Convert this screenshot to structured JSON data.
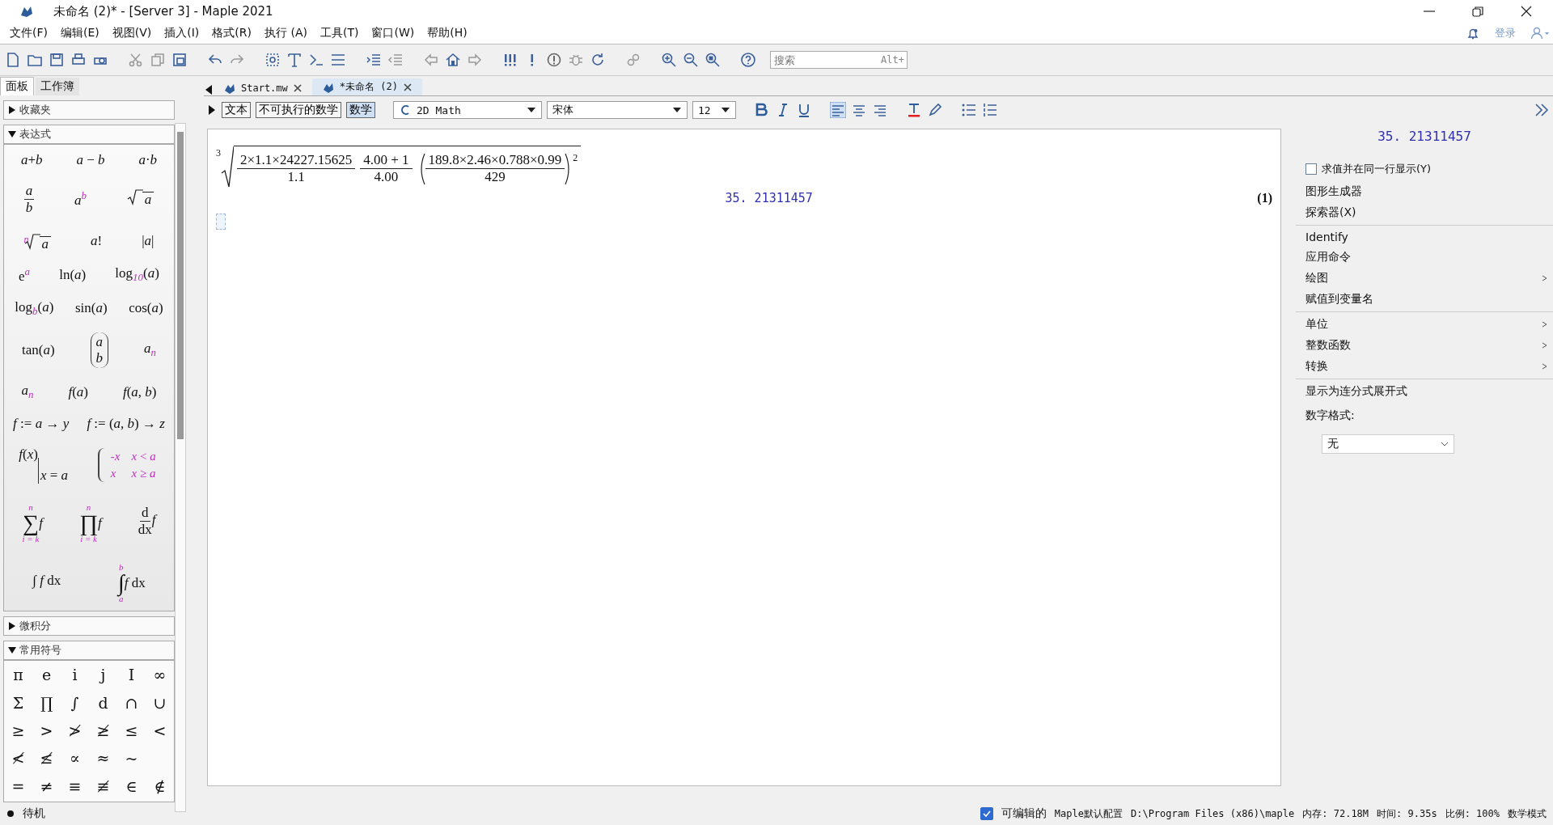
{
  "window": {
    "title": "未命名 (2)* - [Server 3] - Maple 2021",
    "login": "登录"
  },
  "menu": [
    "文件(F)",
    "编辑(E)",
    "视图(V)",
    "插入(I)",
    "格式(R)",
    "执行 (A)",
    "工具(T)",
    "窗口(W)",
    "帮助(H)"
  ],
  "search": {
    "placeholder": "搜索",
    "hint": "Alt+"
  },
  "panel_tabs": [
    {
      "label": "面板",
      "selected": true
    },
    {
      "label": "工作簿",
      "selected": false
    }
  ],
  "doc_tabs": [
    {
      "label": "Start.mw",
      "selected": false
    },
    {
      "label": "*未命名 (2)",
      "selected": true
    }
  ],
  "palettes": [
    {
      "title": "收藏夹",
      "expanded": false
    },
    {
      "title": "表达式",
      "expanded": true,
      "kind": "expressions",
      "rows": [
        [
          {
            "kind": "text",
            "t": "*a*+*b*"
          },
          {
            "kind": "text",
            "t": "*a* − *b*"
          },
          {
            "kind": "text",
            "t": "*a*·*b*"
          }
        ],
        [
          {
            "kind": "frac",
            "num": "*a*",
            "den": "*b*"
          },
          {
            "kind": "text",
            "t": "*a*$^{b}$"
          },
          {
            "kind": "root",
            "body": "*a*"
          }
        ],
        [
          {
            "kind": "root",
            "index": "n",
            "body": "*a*"
          },
          {
            "kind": "text",
            "t": "*a*!"
          },
          {
            "kind": "text",
            "t": "|*a*|"
          }
        ],
        [
          {
            "kind": "text",
            "t": "e$^{a}$"
          },
          {
            "kind": "text",
            "t": "ln(*a*)"
          },
          {
            "kind": "text",
            "t": "log$_{10}$(*a*)"
          }
        ],
        [
          {
            "kind": "text",
            "t": "log$_{b}$(*a*)"
          },
          {
            "kind": "text",
            "t": "sin(*a*)"
          },
          {
            "kind": "text",
            "t": "cos(*a*)"
          }
        ],
        [
          {
            "kind": "text",
            "t": "tan(*a*)"
          },
          {
            "kind": "binom",
            "top": "*a*",
            "bottom": "*b*"
          },
          {
            "kind": "text",
            "t": "*a*$_{n}$"
          }
        ],
        [
          {
            "kind": "text",
            "t": "*a*$_{n}$"
          },
          {
            "kind": "text",
            "t": "*f*(*a*)"
          },
          {
            "kind": "text",
            "t": "*f*(*a*, *b*)"
          }
        ],
        [
          {
            "kind": "text",
            "t": "*f* := *a* → *y*"
          },
          {
            "kind": "text",
            "t": "*f* := (*a*, *b*) → *z*"
          }
        ],
        [
          {
            "kind": "evalat",
            "body": "*f*(*x*)",
            "at": "*x* = *a*"
          },
          {
            "kind": "piecewise",
            "cases": [
              [
                "-*x*",
                "*x* < *a*"
              ],
              [
                "*x*",
                "*x* ≥ *a*"
              ]
            ]
          }
        ],
        [
          {
            "kind": "bigop",
            "op": "∑",
            "upper": "n",
            "lower": "i = k",
            "body": "*f*"
          },
          {
            "kind": "bigop",
            "op": "∏",
            "upper": "n",
            "lower": "i = k",
            "body": "*f*"
          },
          {
            "kind": "frac",
            "num": "d",
            "den": "dx",
            "after": "*f*"
          }
        ],
        [
          {
            "kind": "text",
            "t": "∫ *f* dx"
          },
          {
            "kind": "bigop",
            "op": "∫",
            "upper": "b",
            "lower": "a",
            "body": "*f* dx"
          }
        ]
      ]
    },
    {
      "title": "微积分",
      "expanded": false
    },
    {
      "title": "常用符号",
      "expanded": true,
      "kind": "symbols",
      "rows": [
        [
          "π",
          "e",
          "i",
          "j",
          "I",
          "∞"
        ],
        [
          "Σ",
          "∏",
          "∫",
          "d",
          "∩",
          "∪"
        ],
        [
          "≥",
          ">",
          "≯",
          "≱",
          "≤",
          "<"
        ],
        [
          "≮",
          "≰",
          "∝",
          "≈",
          "~"
        ],
        [
          "=",
          "≠",
          "≡",
          "≢",
          "∈",
          "∉"
        ]
      ]
    }
  ],
  "format_bar": {
    "modes": [
      {
        "label": "文本",
        "selected": false
      },
      {
        "label": "不可执行的数学",
        "selected": false
      },
      {
        "label": "数学",
        "selected": true
      }
    ],
    "style": "2D Math",
    "font": "宋体",
    "size": "12"
  },
  "document": {
    "input": {
      "root_index": "3",
      "factors": [
        {
          "num": "2×1.1×24227.15625",
          "den": "1.1"
        },
        {
          "num": "4.00 + 1",
          "den": "4.00"
        },
        {
          "num": "189.8×2.46×0.788×0.99",
          "den": "429",
          "paren": true,
          "power": "2"
        }
      ]
    },
    "output": "35. 21311457",
    "label": "(1)"
  },
  "context_panel": {
    "result": "35. 21311457",
    "evaluate_inline": {
      "label": "求值并在同一行显示(Y)",
      "checked": false
    },
    "groups": [
      [
        {
          "label": "图形生成器",
          "submenu": false
        },
        {
          "label": "探索器(X)",
          "submenu": false
        }
      ],
      [
        {
          "label": "Identify",
          "submenu": false
        },
        {
          "label": "应用命令",
          "submenu": false
        },
        {
          "label": "绘图",
          "submenu": true
        },
        {
          "label": "赋值到变量名",
          "submenu": false
        }
      ],
      [
        {
          "label": "单位",
          "submenu": true
        },
        {
          "label": "整数函数",
          "submenu": true
        },
        {
          "label": "转换",
          "submenu": true
        }
      ],
      [
        {
          "label": "显示为连分式展开式",
          "submenu": false
        }
      ]
    ],
    "number_format": {
      "label": "数字格式:",
      "value": "无"
    }
  },
  "status_bar": {
    "state": "待机",
    "editable": {
      "label": "可编辑的",
      "checked": true
    },
    "items": [
      "Maple默认配置",
      "D:\\Program Files (x86)\\maple",
      "内存: 72.18M",
      "时间: 9.35s",
      "比例: 100%",
      "数学模式"
    ]
  }
}
